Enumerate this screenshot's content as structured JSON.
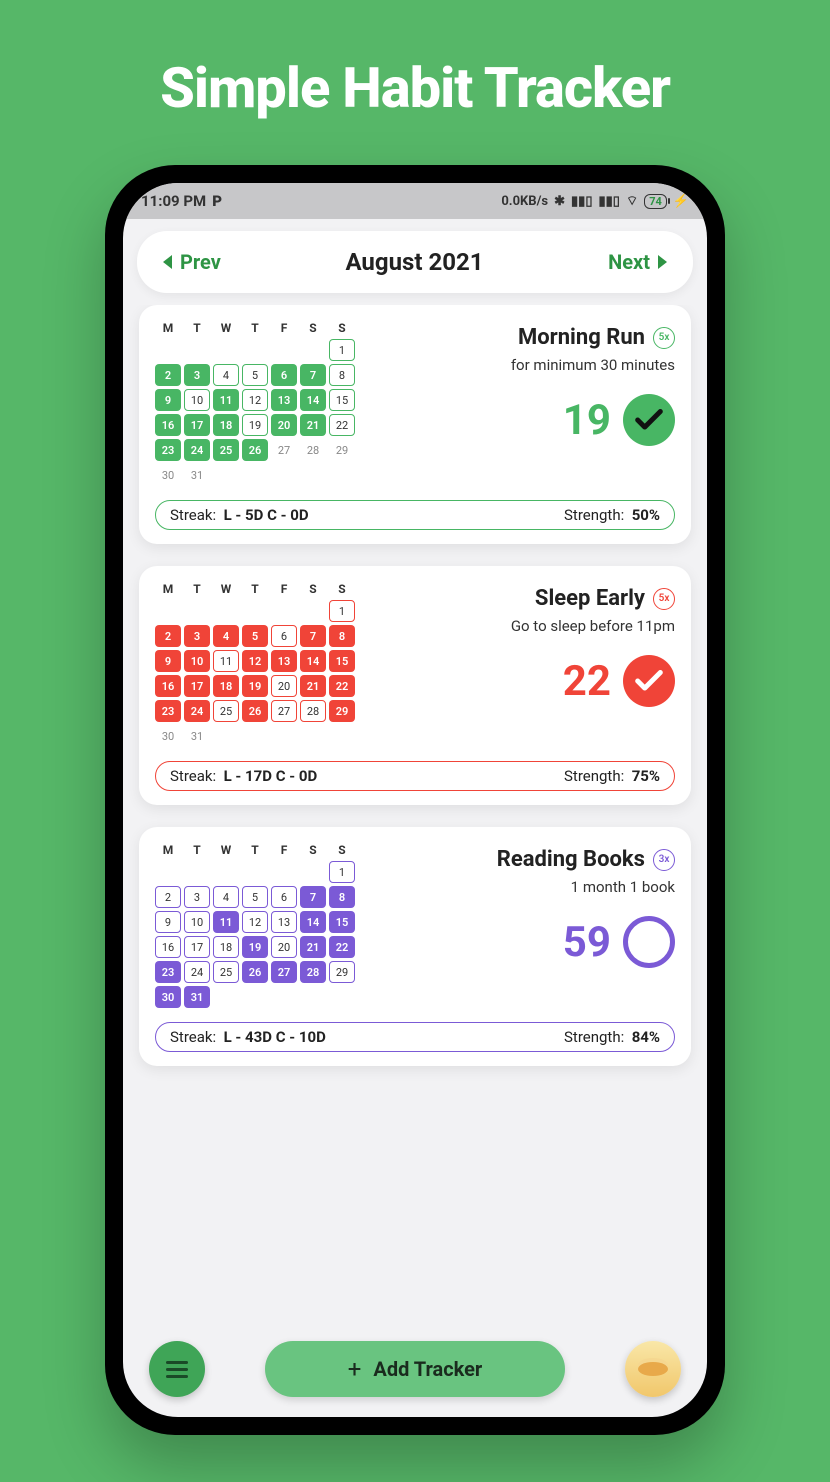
{
  "promo_title": "Simple Habit Tracker",
  "status": {
    "time": "11:09 PM",
    "net": "0.0KB/s",
    "battery": "74"
  },
  "nav": {
    "prev": "Prev",
    "title": "August 2021",
    "next": "Next"
  },
  "dow": [
    "M",
    "T",
    "W",
    "T",
    "F",
    "S",
    "S"
  ],
  "habits": [
    {
      "color": "#48b664",
      "name": "Morning Run",
      "freq": "5x",
      "sub": "for minimum 30 minutes",
      "count": "19",
      "checked": true,
      "streak_label": "Streak:",
      "streak_val": "L - 5D  C - 0D",
      "strength_label": "Strength:",
      "strength_val": "50%",
      "first_weekday": 6,
      "last_day": 31,
      "today": 26,
      "done_days": [
        2,
        3,
        6,
        7,
        9,
        11,
        13,
        14,
        16,
        17,
        18,
        20,
        21,
        23,
        24,
        25,
        26
      ],
      "outline_rows": []
    },
    {
      "color": "#f04438",
      "name": "Sleep Early",
      "freq": "5x",
      "sub": "Go to sleep before 11pm",
      "count": "22",
      "checked": true,
      "streak_label": "Streak:",
      "streak_val": "L - 17D  C - 0D",
      "strength_label": "Strength:",
      "strength_val": "75%",
      "first_weekday": 6,
      "last_day": 31,
      "today": 29,
      "done_days": [
        2,
        3,
        4,
        5,
        7,
        8,
        9,
        10,
        12,
        13,
        14,
        15,
        16,
        17,
        18,
        19,
        21,
        22,
        23,
        24,
        26,
        29
      ],
      "outline_rows": []
    },
    {
      "color": "#7b5ad6",
      "name": "Reading Books",
      "freq": "3x",
      "sub": "1 month 1 book",
      "count": "59",
      "checked": false,
      "streak_label": "Streak:",
      "streak_val": "L - 43D  C - 10D",
      "strength_label": "Strength:",
      "strength_val": "84%",
      "first_weekday": 6,
      "last_day": 31,
      "today": 31,
      "done_days": [
        7,
        8,
        11,
        14,
        15,
        19,
        21,
        22,
        23,
        26,
        27,
        28,
        30,
        31
      ],
      "outline_rows": [
        0,
        1,
        2,
        3
      ]
    }
  ],
  "bottom": {
    "add": "Add Tracker"
  }
}
